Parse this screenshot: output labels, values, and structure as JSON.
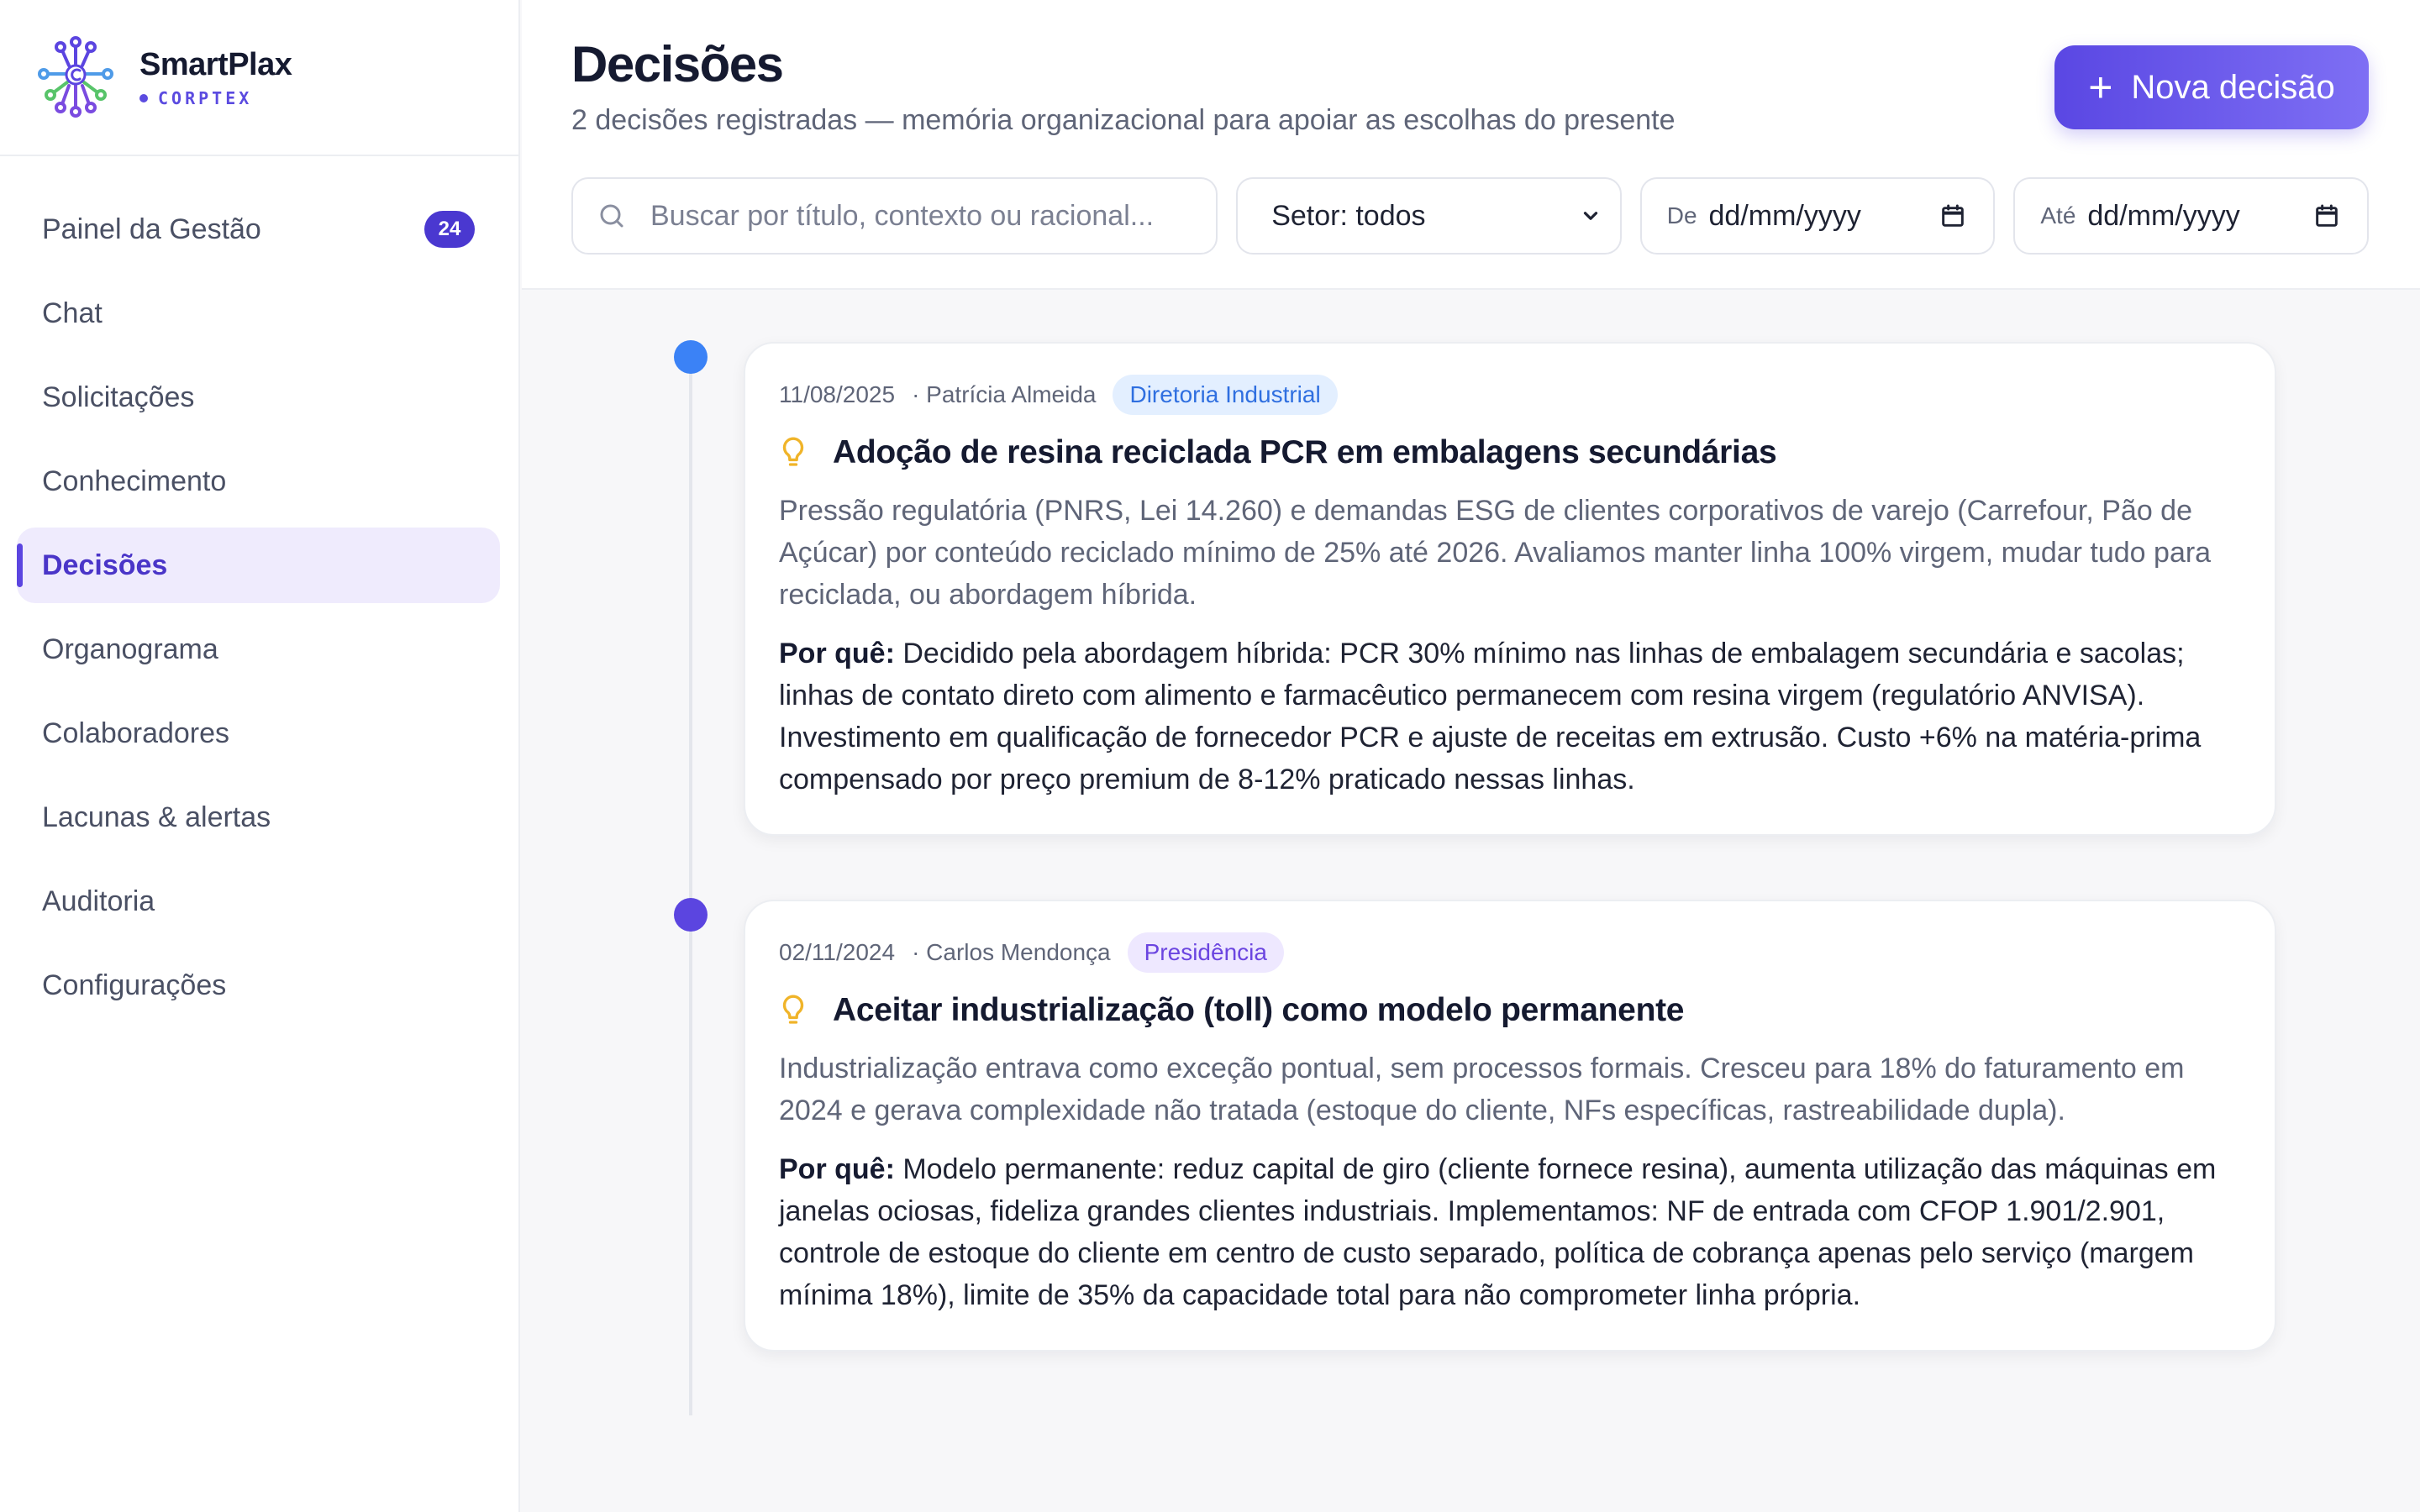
{
  "brand": {
    "name": "SmartPlax",
    "sub": "CORPTEX"
  },
  "sidebar": {
    "items": [
      {
        "label": "Painel da Gestão",
        "badge": "24"
      },
      {
        "label": "Chat"
      },
      {
        "label": "Solicitações"
      },
      {
        "label": "Conhecimento"
      },
      {
        "label": "Decisões",
        "active": true
      },
      {
        "label": "Organograma"
      },
      {
        "label": "Colaboradores"
      },
      {
        "label": "Lacunas & alertas"
      },
      {
        "label": "Auditoria"
      },
      {
        "label": "Configurações"
      }
    ]
  },
  "header": {
    "title": "Decisões",
    "subtitle": "2 decisões registradas — memória organizacional para apoiar as escolhas do presente",
    "new_button": "Nova decisão"
  },
  "filters": {
    "search_placeholder": "Buscar por título, contexto ou racional...",
    "sector": "Setor: todos",
    "from_label": "De",
    "from_value": "dd/mm/yyyy",
    "to_label": "Até",
    "to_value": "dd/mm/yyyy"
  },
  "decisions": [
    {
      "date": "11/08/2025",
      "author": "· Patrícia Almeida",
      "sector": "Diretoria Industrial",
      "title": "Adoção de resina reciclada PCR em embalagens secundárias",
      "context": "Pressão regulatória (PNRS, Lei 14.260) e demandas ESG de clientes corporativos de varejo (Carrefour, Pão de Açúcar) por conteúdo reciclado mínimo de 25% até 2026. Avaliamos manter linha 100% virgem, mudar tudo para reciclada, ou abordagem híbrida.",
      "why_label": "Por quê:",
      "why": "Decidido pela abordagem híbrida: PCR 30% mínimo nas linhas de embalagem secundária e sacolas; linhas de contato direto com alimento e farmacêutico permanecem com resina virgem (regulatório ANVISA). Investimento em qualificação de fornecedor PCR e ajuste de receitas em extrusão. Custo +6% na matéria-prima compensado por preço premium de 8-12% praticado nessas linhas."
    },
    {
      "date": "02/11/2024",
      "author": "· Carlos Mendonça",
      "sector": "Presidência",
      "title": "Aceitar industrialização (toll) como modelo permanente",
      "context": "Industrialização entrava como exceção pontual, sem processos formais. Cresceu para 18% do faturamento em 2024 e gerava complexidade não tratada (estoque do cliente, NFs específicas, rastreabilidade dupla).",
      "why_label": "Por quê:",
      "why": "Modelo permanente: reduz capital de giro (cliente fornece resina), aumenta utilização das máquinas em janelas ociosas, fideliza grandes clientes industriais. Implementamos: NF de entrada com CFOP 1.901/2.901, controle de estoque do cliente em centro de custo separado, política de cobrança apenas pelo serviço (margem mínima 18%), limite de 35% da capacidade total para não comprometer linha própria."
    }
  ],
  "colors": {
    "accent": "#5a47e3",
    "dot_1": "#3b82f6",
    "dot_2": "#5b45e0",
    "tag_1_bg": "#e3efff",
    "tag_1_fg": "#2f6fe0",
    "tag_2_bg": "#eee8ff",
    "tag_2_fg": "#6b45e0",
    "bulb": "#f0b429"
  },
  "icons": {
    "search": "search-icon",
    "chevron": "chevron-down-icon",
    "calendar": "calendar-icon",
    "bulb": "lightbulb-icon",
    "plus": "plus-icon"
  }
}
